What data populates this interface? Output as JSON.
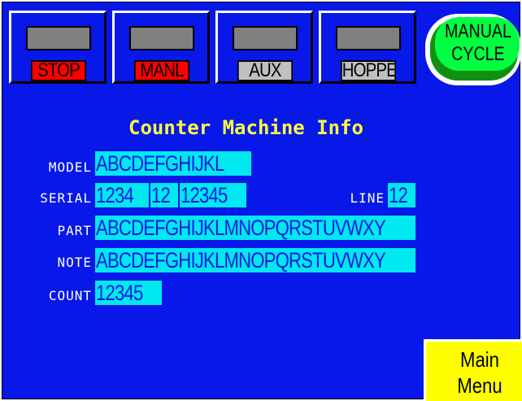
{
  "toolbar": {
    "buttons": [
      {
        "label": "STOP"
      },
      {
        "label": "MANL"
      },
      {
        "label": "AUX"
      },
      {
        "label": "HOPPER"
      }
    ],
    "manual_cycle": {
      "line1": "MANUAL",
      "line2": "CYCLE"
    }
  },
  "title": "Counter Machine Info",
  "fields": {
    "model": {
      "label": "MODEL",
      "value": "ABCDEFGHIJKL"
    },
    "serial": {
      "label": "SERIAL",
      "part1": "1234",
      "part2": "12",
      "part3": "12345"
    },
    "line": {
      "label": "LINE",
      "value": "12"
    },
    "part": {
      "label": "PART",
      "value": "ABCDEFGHIJKLMNOPQRSTUVWXY"
    },
    "note": {
      "label": "NOTE",
      "value": "ABCDEFGHIJKLMNOPQRSTUVWXY"
    },
    "count": {
      "label": "COUNT",
      "value": "12345"
    }
  },
  "main_menu": {
    "line1": "Main",
    "line2": "Menu"
  },
  "colors": {
    "background": "#0818e8",
    "field": "#00e8f0",
    "title": "#ffff40",
    "stop_label": "#ff0000",
    "manual_cycle": "#00ff40",
    "main_menu": "#ffff00"
  }
}
